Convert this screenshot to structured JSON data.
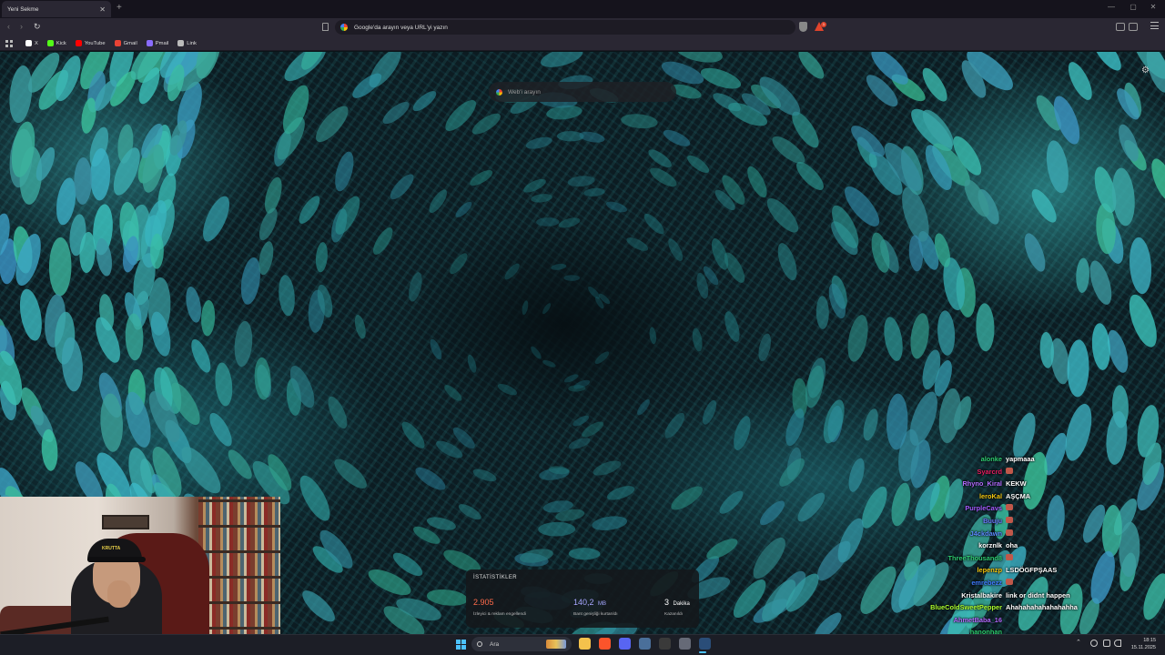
{
  "browser": {
    "tab_title": "Yeni Sekme",
    "tab_close": "✕",
    "new_tab": "+",
    "window_controls": [
      "—",
      "▢",
      "✕"
    ],
    "back": "‹",
    "forward": "›",
    "reload": "↻",
    "url_placeholder": "Google'da arayın veya URL'yi yazın",
    "notification_count": "1"
  },
  "bookmarks": [
    {
      "label": "X",
      "icon": "x-icon",
      "color": "#ffffff"
    },
    {
      "label": "Kick",
      "icon": "kick-icon",
      "color": "#53fc18"
    },
    {
      "label": "YouTube",
      "icon": "youtube-icon",
      "color": "#ff0000"
    },
    {
      "label": "Gmail",
      "icon": "gmail-icon",
      "color": "#ea4335"
    },
    {
      "label": "Pmail",
      "icon": "pmail-icon",
      "color": "#8a6cff"
    },
    {
      "label": "Link",
      "icon": "link-icon",
      "color": "#bbbbbb"
    }
  ],
  "newtab": {
    "search_placeholder": "Web'i arayın",
    "settings_icon": "⚙",
    "stats": {
      "title": "İSTATİSTİKLER",
      "items": [
        {
          "value": "2.905",
          "unit": "",
          "label": "İzleyici & reklam engellendi",
          "color": "#ff6b4a"
        },
        {
          "value": "140,2",
          "unit": "MB",
          "label": "Bant genişliği kurtarıldı",
          "color": "#a7a6ff"
        },
        {
          "value": "3",
          "unit": "Dakika",
          "label": "Kazanıldı",
          "color": "#ffffff"
        }
      ]
    }
  },
  "webcam": {
    "cap_text": "KRUTTA"
  },
  "chat": [
    {
      "user": "alonke",
      "message": "yapmaaa",
      "color": "#2ecc71",
      "emote": false
    },
    {
      "user": "Syarcrd",
      "message": "",
      "color": "#e91e63",
      "emote": true
    },
    {
      "user": "Rhyno_Kiral",
      "message": "KEKW",
      "color": "#b36bff",
      "emote": false
    },
    {
      "user": "leroKal",
      "message": "AŞÇMA",
      "color": "#f1c40f",
      "emote": false
    },
    {
      "user": "PurpleCavs",
      "message": "",
      "color": "#a45cff",
      "emote": true
    },
    {
      "user": "Buuju",
      "message": "",
      "color": "#6c7bff",
      "emote": true
    },
    {
      "user": "J4ckdawn",
      "message": "",
      "color": "#5c8aff",
      "emote": true
    },
    {
      "user": "korznlk",
      "message": "oha",
      "color": "#ffffff",
      "emote": false
    },
    {
      "user": "ThreeThousand8",
      "message": "",
      "color": "#2ecc71",
      "emote": true
    },
    {
      "user": "lepenzp",
      "message": "LSDÖGFPŞAAS",
      "color": "#f1c40f",
      "emote": false
    },
    {
      "user": "emrebezz",
      "message": "",
      "color": "#3f7cff",
      "emote": true
    },
    {
      "user": "Kristalbakire",
      "message": "link or didnt happen",
      "color": "#ffffff",
      "emote": false
    },
    {
      "user": "BlueColdSweetPepper",
      "message": "Ahahahahahahahahha",
      "color": "#adff2f",
      "emote": false
    },
    {
      "user": "AhmetBaba_16",
      "message": "",
      "color": "#b36bff",
      "emote": false
    },
    {
      "user": "hanonhan",
      "message": "",
      "color": "#2ecc71",
      "emote": false
    }
  ],
  "taskbar": {
    "search_label": "Ara",
    "time": "18:15",
    "date": "15.11.2025",
    "apps": [
      {
        "name": "file-explorer-icon",
        "color": "#f5c24c"
      },
      {
        "name": "brave-icon",
        "color": "#fb542b"
      },
      {
        "name": "discord-icon",
        "color": "#5865f2"
      },
      {
        "name": "steam-icon",
        "color": "#4a6f9a"
      },
      {
        "name": "obs-icon",
        "color": "#3a3a3a"
      },
      {
        "name": "game-icon",
        "color": "#666a77"
      },
      {
        "name": "steam-active-icon",
        "color": "#2a4d78"
      }
    ]
  }
}
